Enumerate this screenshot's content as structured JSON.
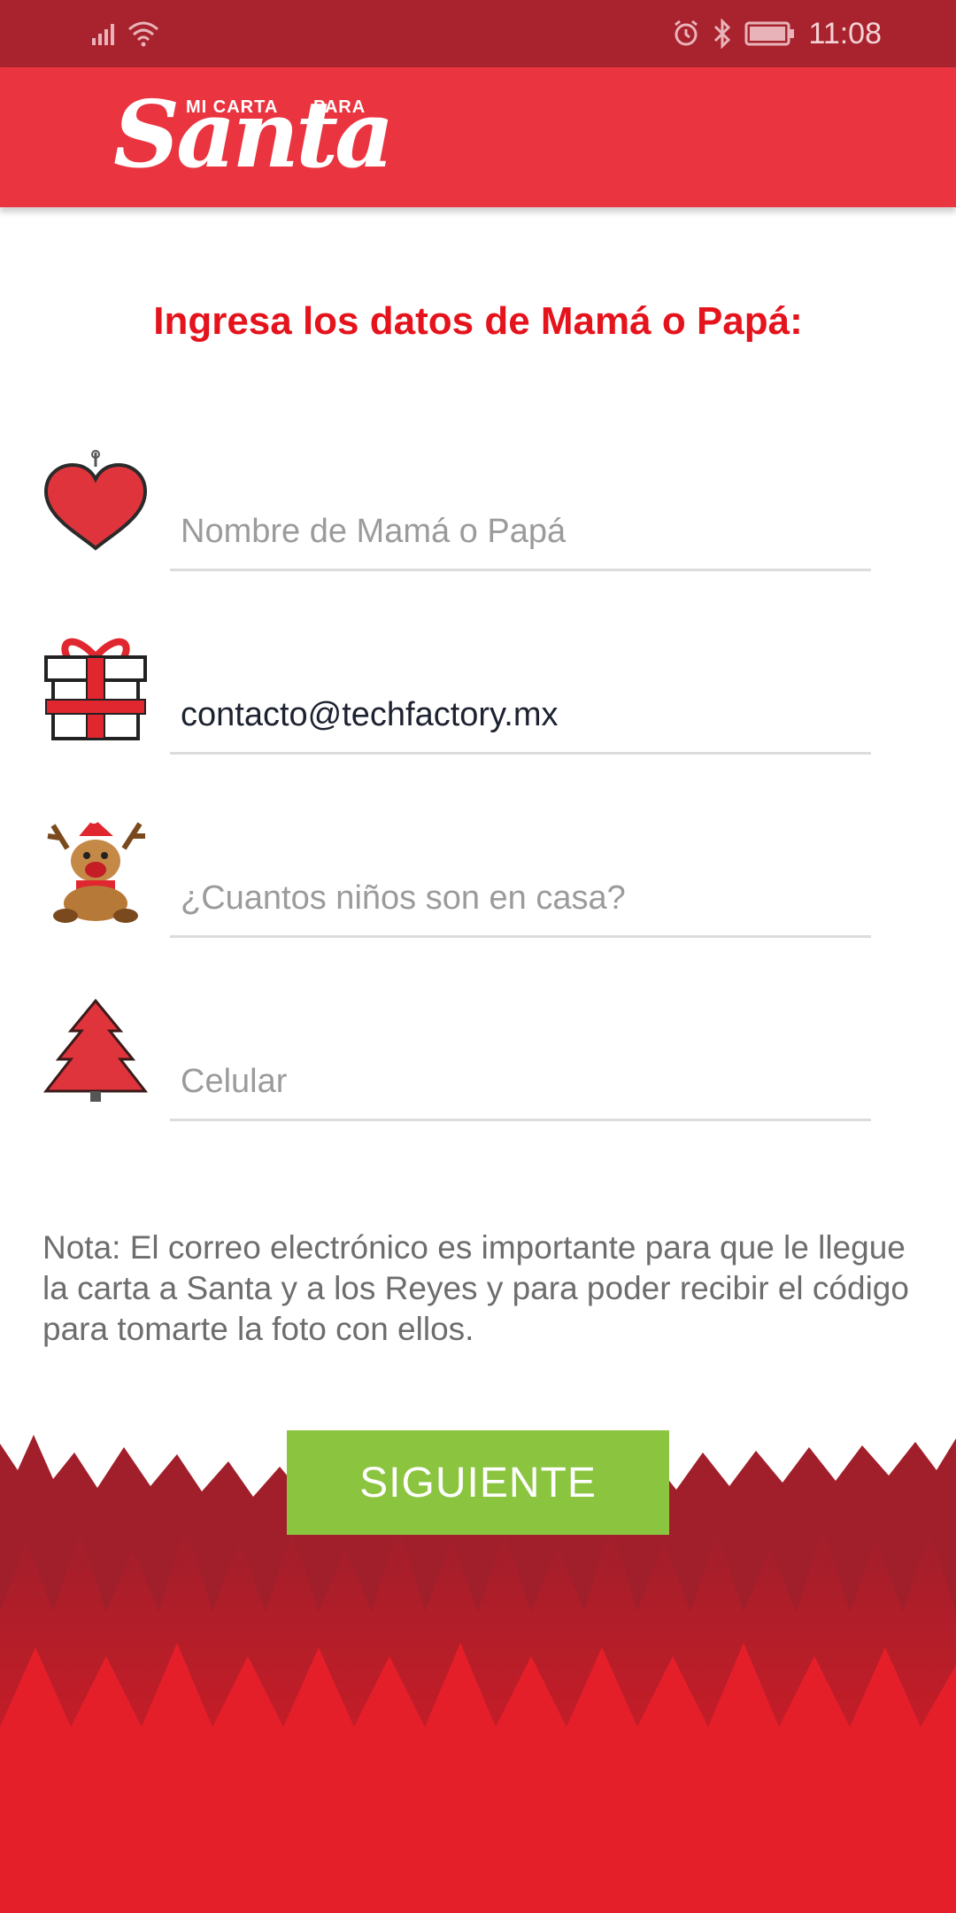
{
  "status_bar": {
    "time": "11:08"
  },
  "header": {
    "logo": {
      "small_left": "MI CARTA",
      "small_right": "PARA",
      "big": "Santa"
    }
  },
  "form": {
    "title": "Ingresa los datos de Mamá o Papá:",
    "fields": [
      {
        "icon": "heart-icon",
        "placeholder": "Nombre de Mamá o Papá",
        "value": ""
      },
      {
        "icon": "gift-icon",
        "placeholder": "",
        "value": "contacto@techfactory.mx"
      },
      {
        "icon": "reindeer-icon",
        "placeholder": "¿Cuantos niños son en casa?",
        "value": ""
      },
      {
        "icon": "christmas-tree-icon",
        "placeholder": "Celular",
        "value": ""
      }
    ],
    "note": "Nota: El correo electrónico es importante para que le llegue la carta a Santa y a los Reyes y para poder recibir el código para tomarte la foto con ellos.",
    "next_label": "SIGUIENTE"
  },
  "colors": {
    "status_bar": "#a8232e",
    "app_bar": "#ea3540",
    "title": "#e5131c",
    "button": "#8bc540",
    "forest_dark": "#a01f2b",
    "forest_bright": "#e51f2a"
  }
}
